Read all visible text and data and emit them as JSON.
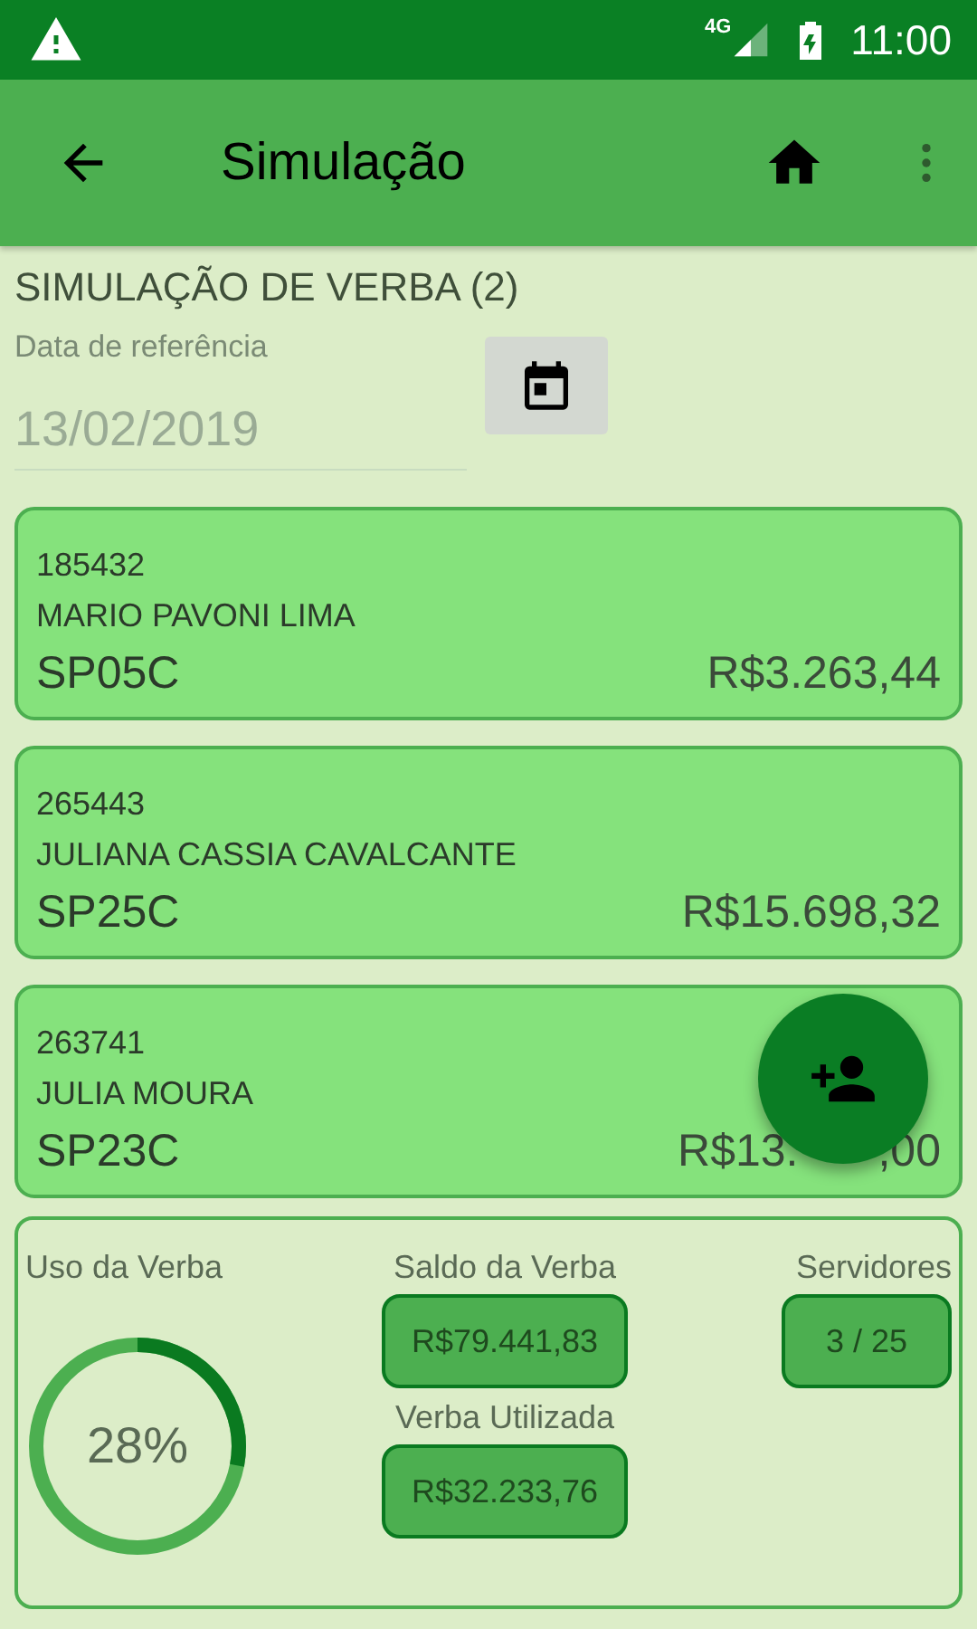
{
  "status_bar": {
    "network": "4G",
    "time": "11:00"
  },
  "app_bar": {
    "title": "Simulação"
  },
  "header": {
    "title": "SIMULAÇÃO DE VERBA (2)",
    "date_field": {
      "label": "Data de referência",
      "value": "13/02/2019"
    }
  },
  "servers": [
    {
      "code": "185432",
      "name": "MARIO PAVONI LIMA",
      "class": "SP05C",
      "value_parts": [
        "R$3.263,44"
      ]
    },
    {
      "code": "265443",
      "name": "JULIANA CASSIA CAVALCANTE",
      "class": "SP25C",
      "value_parts": [
        "R$15.698,32"
      ]
    },
    {
      "code": "263741",
      "name": "JULIA MOURA",
      "class": "SP23C",
      "value_parts": [
        "R$13.",
        ",00"
      ]
    }
  ],
  "summary": {
    "usage": {
      "label": "Uso da Verba",
      "level": 0.28,
      "reading": "28%"
    },
    "balance": {
      "label": "Saldo da Verba",
      "value": "R$79.441,83"
    },
    "used": {
      "label": "Verba Utilizada",
      "value": "R$32.233,76"
    },
    "servers": {
      "label": "Servidores",
      "value": "3 / 25"
    }
  }
}
